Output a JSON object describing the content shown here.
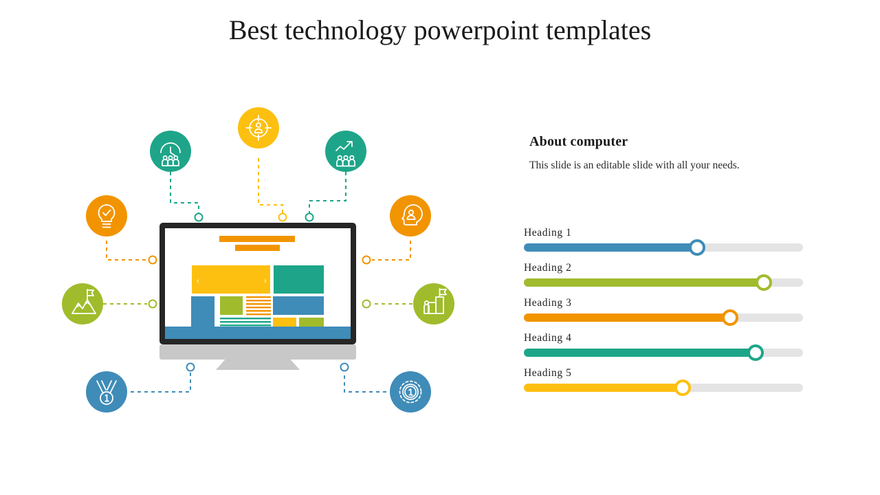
{
  "slide": {
    "title": "Best technology powerpoint templates",
    "background": "#ffffff"
  },
  "about": {
    "heading": "About computer",
    "description": "This slide is an editable slide with all your needs."
  },
  "sliders": [
    {
      "label": "Heading 1",
      "value": 62,
      "color": "#3f8cb8"
    },
    {
      "label": "Heading 2",
      "value": 86,
      "color": "#a0bc2c"
    },
    {
      "label": "Heading 3",
      "value": 74,
      "color": "#f29400"
    },
    {
      "label": "Heading 4",
      "value": 83,
      "color": "#1ea589"
    },
    {
      "label": "Heading 5",
      "value": 57,
      "color": "#fdc010"
    }
  ],
  "palette": {
    "teal": "#1ea589",
    "yellow": "#fdc010",
    "orange": "#f29400",
    "olive": "#a0bc2c",
    "blue": "#3f8cb8",
    "track_gray": "#e4e4e4",
    "bezel_dark": "#262626",
    "stand_gray": "#c8c8c8"
  },
  "illustration": {
    "monitor": {
      "name": "desktop-computer",
      "screen_blocks": [
        {
          "name": "header-bar-1",
          "color": "#f29400"
        },
        {
          "name": "header-bar-2",
          "color": "#f29400"
        },
        {
          "name": "carousel-hero",
          "color": "#fdc010",
          "prev_glyph": "‹",
          "next_glyph": "›"
        },
        {
          "name": "panel-teal",
          "color": "#1ea589"
        },
        {
          "name": "sidebar-blue",
          "color": "#3f8cb8"
        },
        {
          "name": "thumb-olive",
          "color": "#a0bc2c"
        },
        {
          "name": "text-lines-orange",
          "color": "#f29400"
        },
        {
          "name": "banner-blue",
          "color": "#3f8cb8"
        },
        {
          "name": "text-lines-teal",
          "color": "#1ea589"
        },
        {
          "name": "tile-yellow",
          "color": "#fdc010"
        },
        {
          "name": "tile-olive",
          "color": "#a0bc2c"
        },
        {
          "name": "footer-blue",
          "color": "#3f8cb8"
        }
      ]
    },
    "icons": [
      {
        "name": "clock-team-icon",
        "color": "#1ea589",
        "position": "top-left"
      },
      {
        "name": "target-person-icon",
        "color": "#fdc010",
        "position": "top-center"
      },
      {
        "name": "growth-team-icon",
        "color": "#1ea589",
        "position": "top-right"
      },
      {
        "name": "lightbulb-check-icon",
        "color": "#f29400",
        "position": "upper-left"
      },
      {
        "name": "head-person-icon",
        "color": "#f29400",
        "position": "upper-right"
      },
      {
        "name": "mountain-flag-icon",
        "color": "#a0bc2c",
        "position": "lower-left"
      },
      {
        "name": "podium-flag-icon",
        "color": "#a0bc2c",
        "position": "lower-right"
      },
      {
        "name": "medal-icon",
        "color": "#3f8cb8",
        "position": "bottom-left"
      },
      {
        "name": "badge-coin-icon",
        "color": "#3f8cb8",
        "position": "bottom-right"
      }
    ]
  }
}
